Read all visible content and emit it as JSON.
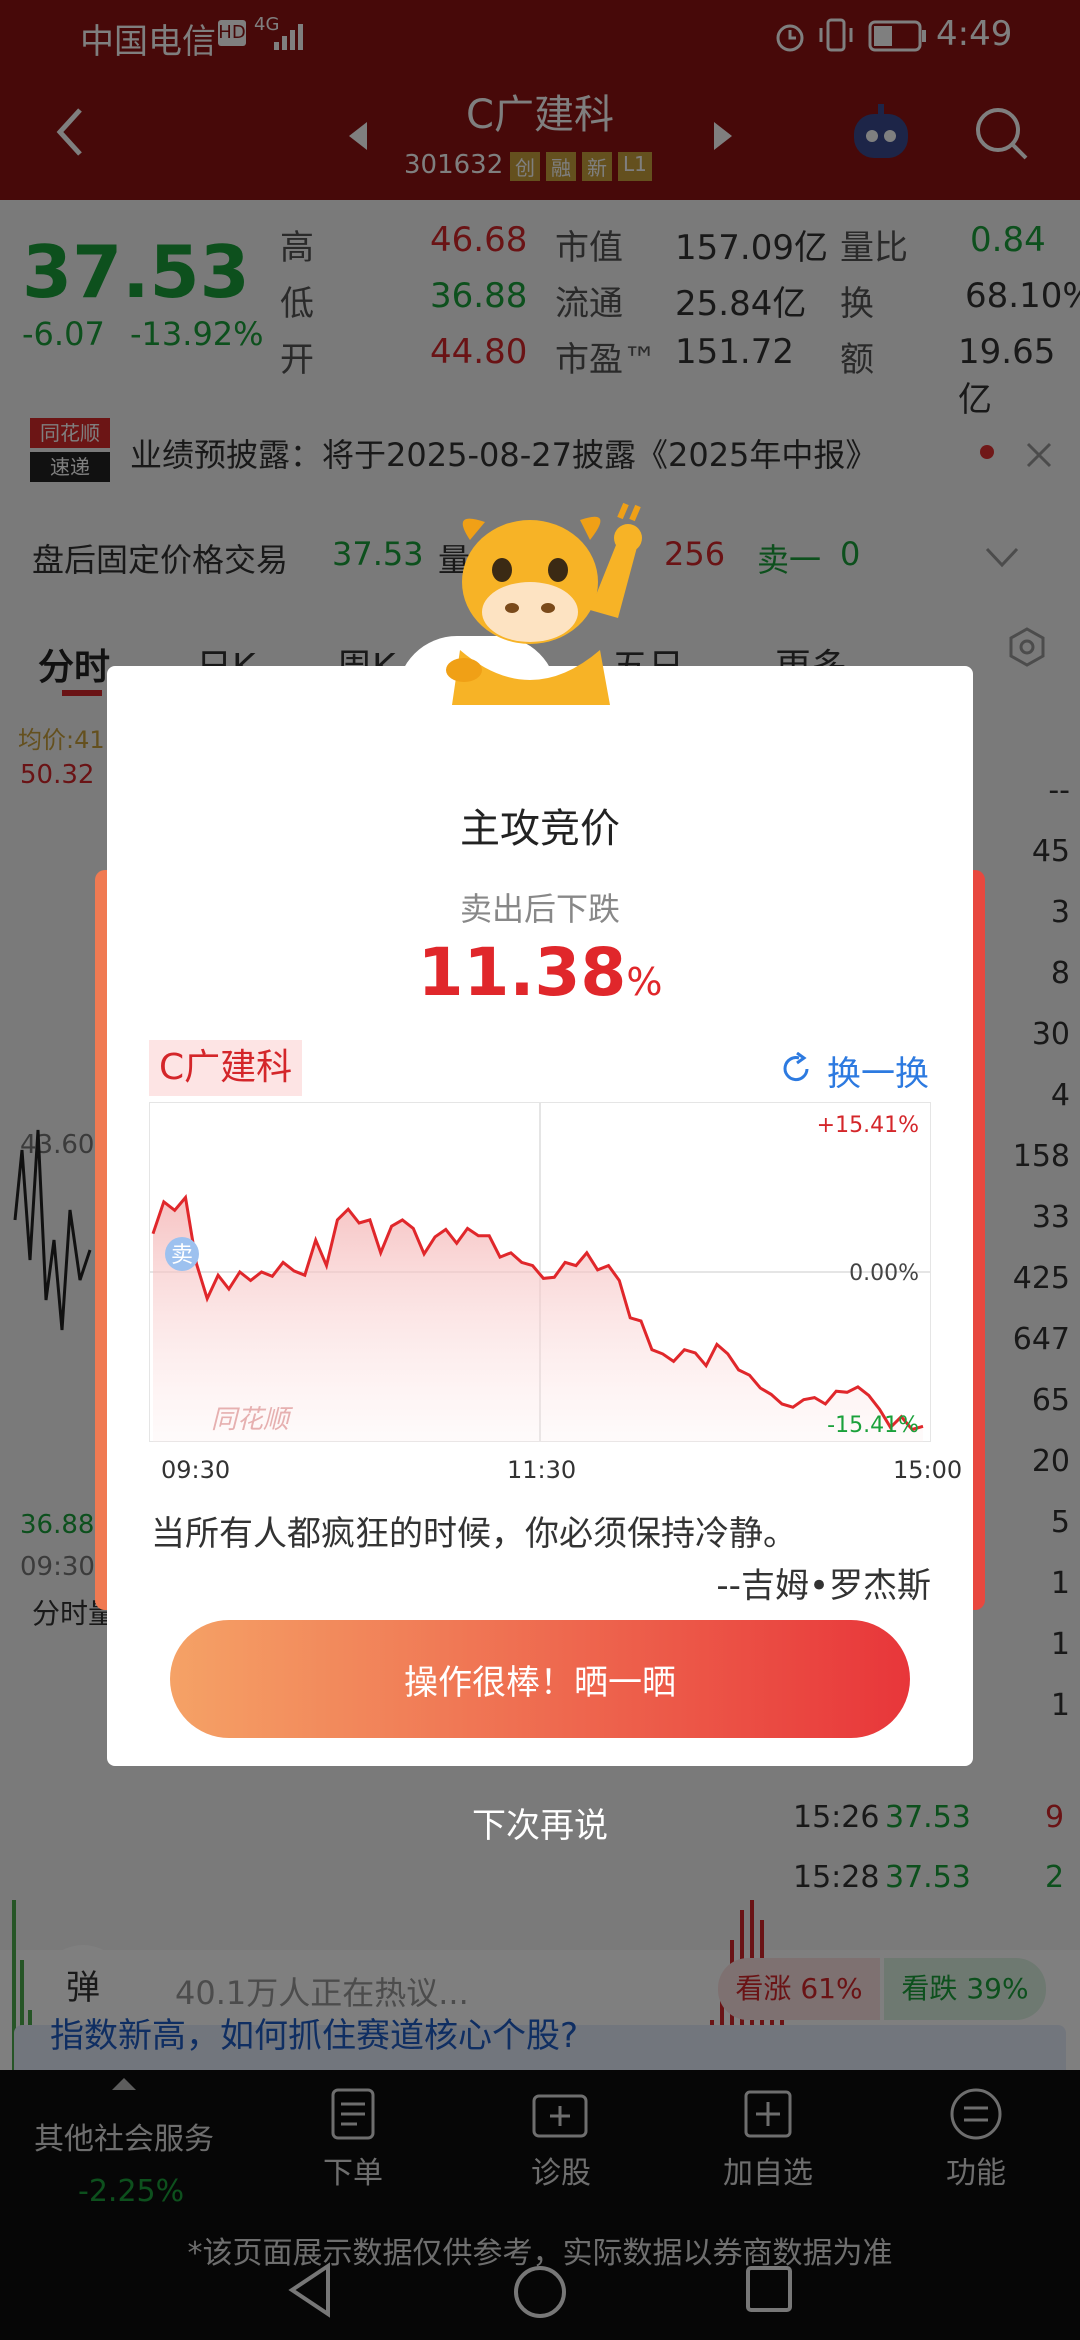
{
  "status_bar": {
    "carrier": "中国电信",
    "net": "4G",
    "time": "4:49"
  },
  "header": {
    "stock_name": "C广建科",
    "stock_code": "301632",
    "tags": [
      "创",
      "融",
      "新",
      "L1"
    ]
  },
  "quote": {
    "price": "37.53",
    "change": "-6.07",
    "change_pct": "-13.92%",
    "rows": [
      {
        "k1": "高",
        "v1": "46.68",
        "k2": "市值",
        "v2": "157.09亿",
        "k3": "量比",
        "v3": "0.84"
      },
      {
        "k1": "低",
        "v1": "36.88",
        "k2": "流通",
        "v2": "25.84亿",
        "k3": "换",
        "v3": "68.10%"
      },
      {
        "k1": "开",
        "v1": "44.80",
        "k2": "市盈™",
        "v2": "151.72",
        "k3": "额",
        "v3": "19.65亿"
      }
    ]
  },
  "notice": {
    "logo_top": "同花顺",
    "logo_bottom": "速递",
    "text": "业绩预披露：将于2025-08-27披露《2025年中报》"
  },
  "after_hours": {
    "label": "盘后固定价格交易",
    "price": "37.53",
    "buy_label": "量",
    "buy_value": "256",
    "sell_label": "卖一",
    "sell_value": "0"
  },
  "chart_tabs": [
    "分时",
    "日K",
    "周K",
    "五日",
    "更多"
  ],
  "bg_left": {
    "avg": "均价:41",
    "top": "50.32",
    "mid": "43.60",
    "bottom": "36.88",
    "time": "09:30",
    "vol_label": "分时量"
  },
  "bg_right_values": [
    "--",
    "45",
    "3",
    "8",
    "30",
    "4",
    "158",
    "33",
    "425",
    "647",
    "65",
    "20",
    "5",
    "1",
    "1",
    "1"
  ],
  "bg_trades": [
    {
      "time": "15:26",
      "price": "37.53",
      "vol": "9"
    },
    {
      "time": "15:28",
      "price": "37.53",
      "vol": "2"
    }
  ],
  "discussion": {
    "icon": "弹",
    "text": "40.1万人正在热议...",
    "bull": "看涨 61%",
    "bear": "看跌 39%"
  },
  "news_banner": "指数新高，如何抓住赛道核心个股?",
  "bottom_nav": {
    "sector": "其他社会服务",
    "sector_change": "-2.25%",
    "items": [
      "下单",
      "诊股",
      "加自选",
      "功能"
    ]
  },
  "disclaimer": "*该页面展示数据仅供参考，实际数据以券商数据为准",
  "dialog": {
    "title": "主攻竞价",
    "subtitle": "卖出后下跌",
    "value": "11.38",
    "unit": "%",
    "stock_tag": "C广建科",
    "refresh_label": "换一换",
    "quote": "当所有人都疯狂的时候，你必须保持冷静。",
    "author": "--吉姆•罗杰斯",
    "share_button": "操作很棒！晒一晒",
    "dismiss": "下次再说",
    "watermark": "同花顺",
    "sell_marker": "卖"
  },
  "chart_data": {
    "type": "line",
    "x_ticks": [
      "09:30",
      "11:30",
      "15:00"
    ],
    "y_labels": {
      "top": "+15.41%",
      "mid": "0.00%",
      "bottom": "-15.41%"
    },
    "ylim": [
      -15.41,
      15.41
    ],
    "series": [
      {
        "values": [
          3.6,
          6.6,
          5.8,
          7.0,
          0.8,
          -2.5,
          -0.3,
          -1.6,
          0.0,
          -0.8,
          0.0,
          -0.4,
          0.9,
          0.1,
          -0.3,
          3.0,
          0.6,
          4.9,
          5.9,
          4.6,
          4.9,
          1.8,
          4.3,
          4.9,
          4.1,
          1.7,
          3.3,
          4.0,
          2.7,
          4.1,
          3.4,
          3.4,
          1.4,
          1.8,
          0.9,
          0.6,
          -0.6,
          -0.5,
          0.9,
          0.6,
          1.8,
          0.2,
          0.6,
          -0.8,
          -4.3,
          -4.6,
          -7.3,
          -7.7,
          -8.4,
          -7.3,
          -7.6,
          -8.8,
          -6.8,
          -7.7,
          -9.2,
          -9.7,
          -10.9,
          -11.5,
          -12.4,
          -12.7,
          -12.0,
          -11.8,
          -12.4,
          -11.2,
          -11.3,
          -10.8,
          -11.6,
          -12.9,
          -14.6,
          -13.6,
          -14.8,
          -14.5
        ]
      }
    ],
    "color": "#e0272b"
  }
}
